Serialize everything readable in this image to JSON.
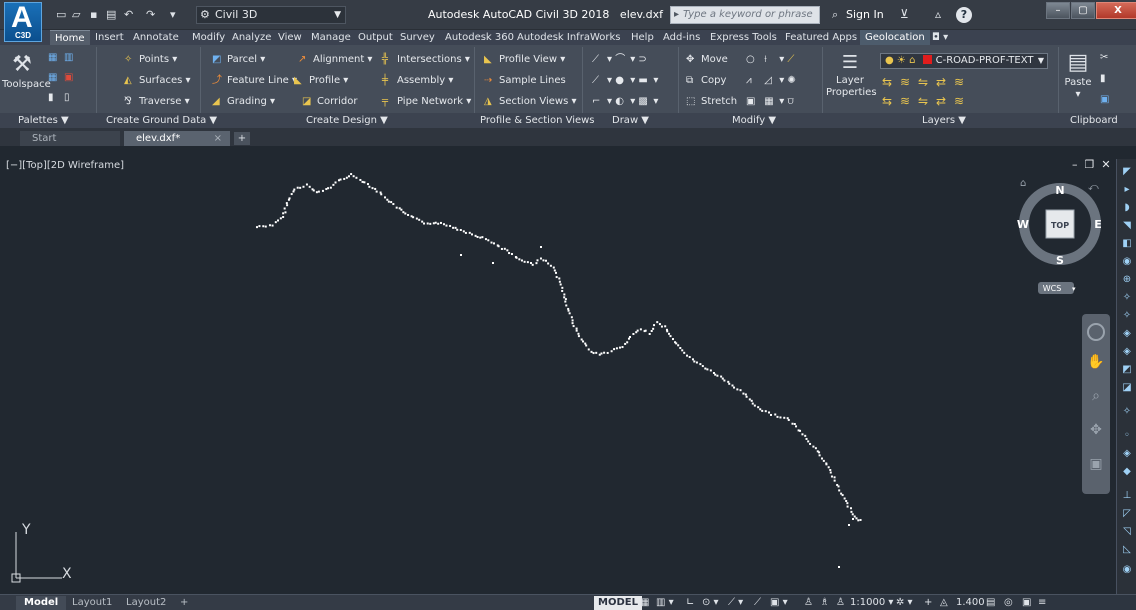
{
  "app": {
    "logo_letter": "A",
    "logo_sub": "C3D",
    "workspace": "Civil 3D",
    "title_product": "Autodesk AutoCAD Civil 3D 2018",
    "title_file": "elev.dxf",
    "search_placeholder": "Type a keyword or phrase",
    "signin": "Sign In"
  },
  "tabs": [
    "Home",
    "Insert",
    "Annotate",
    "Modify",
    "Analyze",
    "View",
    "Manage",
    "Output",
    "Survey",
    "Autodesk 360",
    "Autodesk InfraWorks",
    "Help",
    "Add-ins",
    "Express Tools",
    "Featured Apps",
    "Geolocation"
  ],
  "ribbon": {
    "toolspace": "Toolspace",
    "ground": {
      "points": "Points",
      "surfaces": "Surfaces",
      "traverse": "Traverse"
    },
    "design": {
      "parcel": "Parcel",
      "feature_line": "Feature Line",
      "grading": "Grading",
      "profile": "Profile",
      "corridor": "Corridor",
      "alignment": "Alignment",
      "assembly": "Assembly",
      "pipe_network": "Pipe Network",
      "intersections": "Intersections"
    },
    "profile_section": {
      "profile_view": "Profile View",
      "sample_lines": "Sample Lines",
      "section_views": "Section Views"
    },
    "modify": {
      "move": "Move",
      "copy": "Copy",
      "stretch": "Stretch"
    },
    "layer_properties": "Layer",
    "layer_properties2": "Properties",
    "layer_current": "C-ROAD-PROF-TEXT",
    "paste": "Paste",
    "panels": [
      "Palettes ▼",
      "Create Ground Data ▼",
      "Create Design ▼",
      "Profile & Section Views",
      "Draw ▼",
      "Modify ▼",
      "Layers ▼",
      "Clipboard"
    ]
  },
  "file_tabs": {
    "start": "Start",
    "current": "elev.dxf*"
  },
  "viewport": {
    "label": "[−][Top][2D Wireframe]",
    "viewcube": {
      "top": "TOP",
      "n": "N",
      "s": "S",
      "e": "E",
      "w": "W",
      "wcs": "WCS"
    },
    "ucs_x": "X",
    "ucs_y": "Y"
  },
  "status": {
    "model": "Model",
    "layout1": "Layout1",
    "layout2": "Layout2",
    "model_btn": "MODEL",
    "scale": "1:1000",
    "lineweight": "1.400"
  },
  "colors": {
    "background": "#212830",
    "points": "#ffffff",
    "accent": "#1a70b8"
  }
}
